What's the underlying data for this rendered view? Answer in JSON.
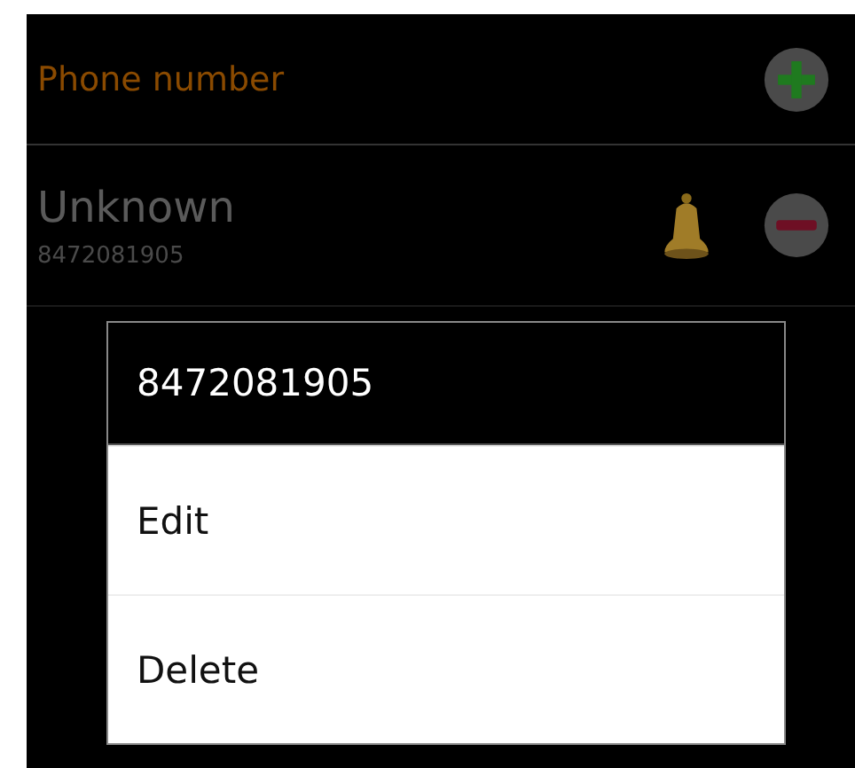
{
  "header": {
    "title": "Phone number"
  },
  "entries": [
    {
      "name": "Unknown",
      "number": "8472081905"
    }
  ],
  "dialog": {
    "title": "8472081905",
    "items": [
      "Edit",
      "Delete"
    ]
  }
}
